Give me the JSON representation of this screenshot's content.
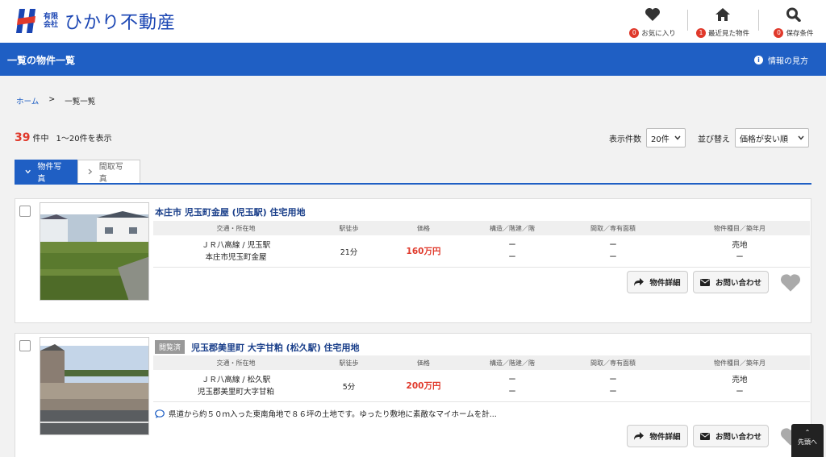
{
  "header": {
    "logo_small": "有限会社",
    "logo_name": "ひかり不動産",
    "nav": [
      {
        "icon": "heart-icon",
        "count": "0",
        "label": "お気に入り"
      },
      {
        "icon": "home-icon",
        "count": "1",
        "label": "最近見た物件"
      },
      {
        "icon": "search-icon",
        "count": "0",
        "label": "保存条件"
      }
    ]
  },
  "bar": {
    "title": "一覧の物件一覧",
    "info_label": "情報の見方"
  },
  "breadcrumb": {
    "home": "ホーム",
    "sep": ">",
    "current": "一覧一覧"
  },
  "results": {
    "count": "39",
    "suffix": "件中",
    "range": "1〜20件を表示"
  },
  "sort": {
    "per_page_label": "表示件数",
    "per_page_value": "20件",
    "order_label": "並び替え",
    "order_value": "価格が安い順"
  },
  "tabs": [
    {
      "label": "物件写真"
    },
    {
      "label": "間取写真"
    }
  ],
  "table_headers": [
    "交通・所在地",
    "駅徒歩",
    "価格",
    "構造／階建／階",
    "間取／専有面積",
    "物件種目／築年月"
  ],
  "listings": [
    {
      "title": "本庄市 児玉町金屋 (児玉駅) 住宅用地",
      "viewed": "",
      "line": "ＪＲ八高線 / 児玉駅",
      "address": "本庄市児玉町金屋",
      "walk": "21分",
      "price": "160万円",
      "structure": [
        "ー",
        "ー"
      ],
      "layout": [
        "ー",
        "ー"
      ],
      "type": [
        "売地",
        "ー"
      ],
      "description": "",
      "detail_btn": "物件詳細",
      "inquiry_btn": "お問い合わせ"
    },
    {
      "title": "児玉郡美里町 大字甘粕 (松久駅) 住宅用地",
      "viewed": "閲覧済",
      "line": "ＪＲ八高線 / 松久駅",
      "address": "児玉郡美里町大字甘粕",
      "walk": "5分",
      "price": "200万円",
      "structure": [
        "ー",
        "ー"
      ],
      "layout": [
        "ー",
        "ー"
      ],
      "type": [
        "売地",
        "ー"
      ],
      "description": "県道から約５０ｍ入った東南角地で８６坪の土地です。ゆったり敷地に素敵なマイホームを計...",
      "detail_btn": "物件詳細",
      "inquiry_btn": "お問い合わせ"
    }
  ],
  "totop": {
    "label": "先頭へ"
  },
  "colors": {
    "brand_blue": "#1f5fc4",
    "price_red": "#e0392b"
  }
}
